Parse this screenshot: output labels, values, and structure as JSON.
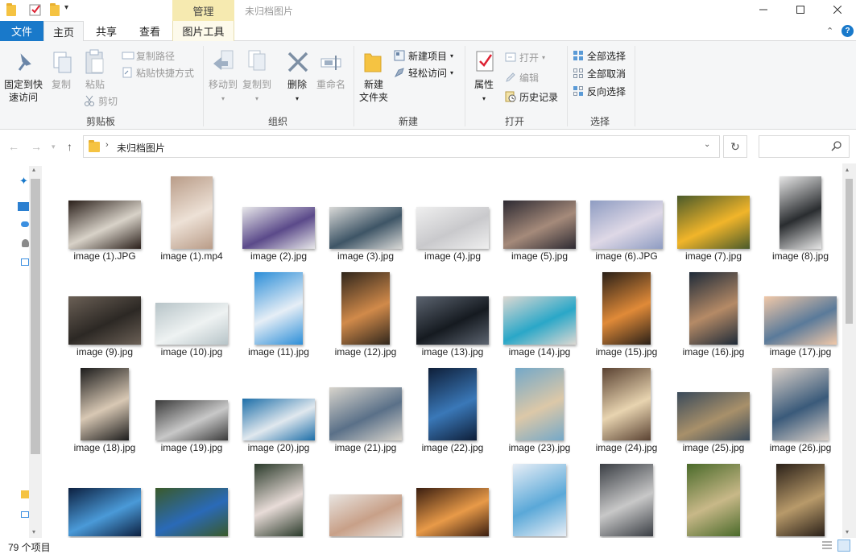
{
  "window": {
    "title": "未归档图片",
    "context_tab": "管理",
    "minimize": "—",
    "maximize": "☐",
    "close": "✕"
  },
  "tabs": {
    "file": "文件",
    "home": "主页",
    "share": "共享",
    "view": "查看",
    "picture_tools": "图片工具"
  },
  "ribbon": {
    "clipboard": {
      "label": "剪贴板",
      "pin": "固定到快\n速访问",
      "copy": "复制",
      "paste": "粘贴",
      "copy_path": "复制路径",
      "paste_shortcut": "粘贴快捷方式",
      "cut": "剪切"
    },
    "organize": {
      "label": "组织",
      "move_to": "移动到",
      "copy_to": "复制到",
      "delete": "删除",
      "rename": "重命名"
    },
    "new": {
      "label": "新建",
      "new_folder": "新建\n文件夹",
      "new_item": "新建项目",
      "easy_access": "轻松访问"
    },
    "open": {
      "label": "打开",
      "properties": "属性",
      "open": "打开",
      "edit": "编辑",
      "history": "历史记录"
    },
    "select": {
      "label": "选择",
      "select_all": "全部选择",
      "select_none": "全部取消",
      "invert": "反向选择"
    }
  },
  "address": {
    "path": "未归档图片"
  },
  "files": [
    "image (1).JPG",
    "image (1).mp4",
    "image (2).jpg",
    "image (3).jpg",
    "image (4).jpg",
    "image (5).jpg",
    "image (6).JPG",
    "image (7).jpg",
    "image (8).jpg",
    "image (9).jpg",
    "image (10).jpg",
    "image (11).jpg",
    "image (12).jpg",
    "image (13).jpg",
    "image (14).jpg",
    "image (15).jpg",
    "image (16).jpg",
    "image (17).jpg",
    "image (18).jpg",
    "image (19).jpg",
    "image (20).jpg",
    "image (21).jpg",
    "image (22).jpg",
    "image (23).jpg",
    "image (24).jpg",
    "image (25).jpg",
    "image (26).jpg"
  ],
  "status": {
    "count": "79 个项目"
  },
  "colors": {
    "accent": "#1979ca",
    "context_tab": "#f6eab0",
    "folder": "#f5c342"
  }
}
